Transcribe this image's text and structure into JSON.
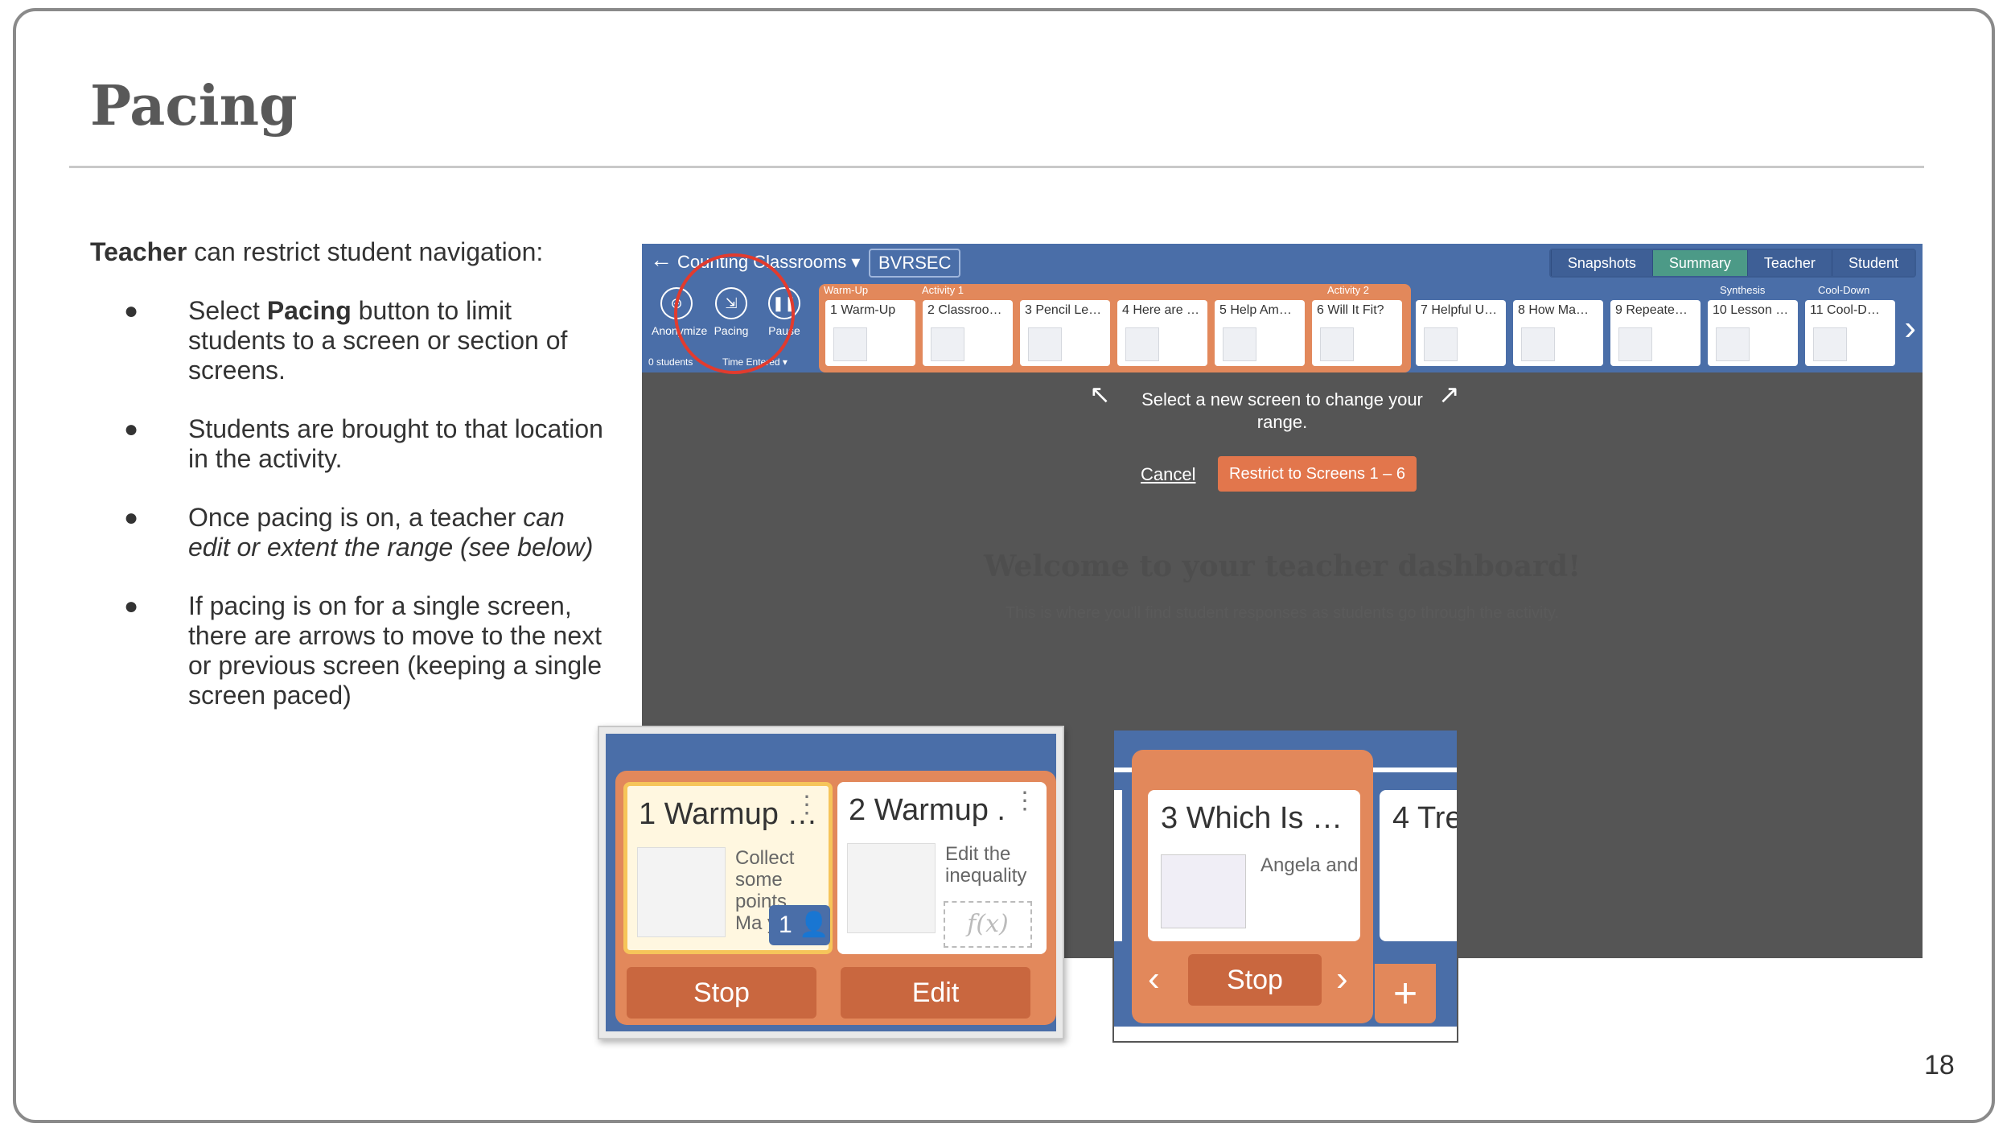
{
  "slide": {
    "title": "Pacing",
    "page_number": "18",
    "intro_bold": "Teacher",
    "intro_rest": " can restrict student navigation:",
    "bullets": [
      {
        "pre": "Select ",
        "bold": "Pacing",
        "post": " button to limit students to a screen or section of screens."
      },
      {
        "text": "Students are brought to that location in the activity."
      },
      {
        "pre": "Once pacing is on, a teacher ",
        "italic": "can edit or extent the range (see below)"
      },
      {
        "text": "If pacing is on for a single screen, there are arrows to move to the next or previous screen (keeping a single screen paced)"
      }
    ]
  },
  "dashboard": {
    "back_icon": "arrow-left-icon",
    "class_name": "Counting Classrooms ▾",
    "class_code": "BVRSEC",
    "tabs": [
      "Snapshots",
      "Summary",
      "Teacher",
      "Student"
    ],
    "active_tab": "Summary",
    "tools": [
      {
        "label": "Anonymize",
        "icon": "anonymize-icon"
      },
      {
        "label": "Pacing",
        "icon": "pacing-icon"
      },
      {
        "label": "Pause",
        "icon": "pause-icon"
      }
    ],
    "students_count": "0 students",
    "time_entered": "Time Entered ▾",
    "sections": [
      "Warm-Up",
      "Activity 1",
      "Activity 2",
      "Synthesis",
      "Cool-Down"
    ],
    "screens": [
      "1 Warm-Up",
      "2 Classroo…",
      "3 Pencil Le…",
      "4 Here are …",
      "5 Help Am…",
      "6 Will It Fit?",
      "7 Helpful U…",
      "8 How Ma…",
      "9 Repeate…",
      "10 Lesson …",
      "11 Cool-D…"
    ],
    "hint": "Select a new screen to change your range.",
    "cancel_label": "Cancel",
    "restrict_label": "Restrict to Screens 1 – 6",
    "ghost_title": "Welcome to your teacher dashboard!",
    "ghost_sub": "This is where you'll find student responses as students go through the activity.",
    "accent_color": "#e2764c",
    "header_color": "#4a6ea8"
  },
  "inset_edit": {
    "card1_title": "1 Warmup …",
    "card1_desc": "Collect some points. Ma you",
    "card1_badge": "1",
    "card2_title": "2 Warmup .",
    "card2_desc": "Edit the inequality",
    "fx_label": "f(x)",
    "stop_label": "Stop",
    "edit_label": "Edit"
  },
  "inset_single": {
    "card3_title": "3 Which Is …",
    "card3_desc": "Angela and",
    "card4_title": "4 Tre",
    "stop_label": "Stop",
    "prev_icon": "chevron-left-icon",
    "next_icon": "chevron-right-icon",
    "plus_icon": "plus-icon"
  }
}
